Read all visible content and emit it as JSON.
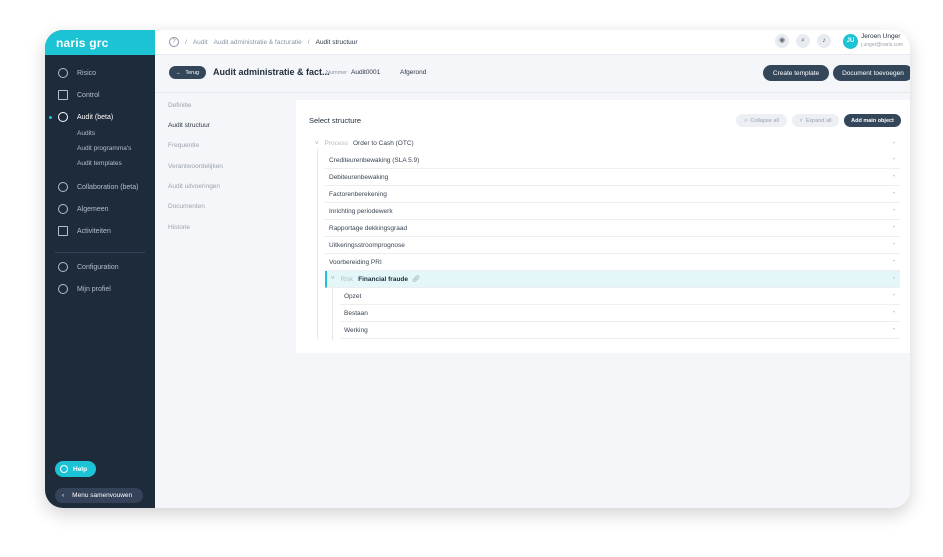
{
  "logo": "naris grc",
  "sidebar": {
    "items": [
      {
        "label": "Risico"
      },
      {
        "label": "Control"
      },
      {
        "label": "Audit (beta)"
      },
      {
        "label": "Collaboration (beta)"
      },
      {
        "label": "Algemeen"
      },
      {
        "label": "Activiteiten"
      },
      {
        "label": "Configuration"
      },
      {
        "label": "Mijn profiel"
      }
    ],
    "subitems": [
      "Audits",
      "Audit programma's",
      "Audit templates"
    ],
    "help": "Help",
    "collapse": "Menu samenvouwen"
  },
  "breadcrumb": {
    "root": "Audit",
    "parent": "Audit administratie & facturatie",
    "current": "Audit structuur",
    "sep": "/"
  },
  "user": {
    "name": "Jeroen Unger",
    "email": "j.unger@naris.com",
    "initials": "JU"
  },
  "header": {
    "back": "Terug",
    "title": "Audit administratie & fact...",
    "number_label": "Nummer",
    "number": "Audit0001",
    "status": "Afgerond",
    "create_template": "Create template",
    "add_document": "Document toevoegen"
  },
  "subnav": [
    "Definitie",
    "Audit structuur",
    "Frequentie",
    "Verantwoordelijken",
    "Audit uitvoeringen",
    "Documenten",
    "Historie"
  ],
  "structure": {
    "title": "Select structure",
    "collapse_all": "Collapse all",
    "expand_all": "Expand all",
    "add_main": "Add main object",
    "process": {
      "type": "Process",
      "name": "Order to Cash (OTC)"
    },
    "children": [
      "Crediteurenbewaking (SLA 5.9)",
      "Debiteurenbewaking",
      "Factorenberekening",
      "Inrichting periodewerk",
      "Rapportage dekkingsgraad",
      "Uitkeringsstroomprognose",
      "Voorbereiding PRI"
    ],
    "risk": {
      "type": "Risk",
      "name": "Financial fraude"
    },
    "risk_children": [
      "Opzet",
      "Bestaan",
      "Werking"
    ]
  }
}
